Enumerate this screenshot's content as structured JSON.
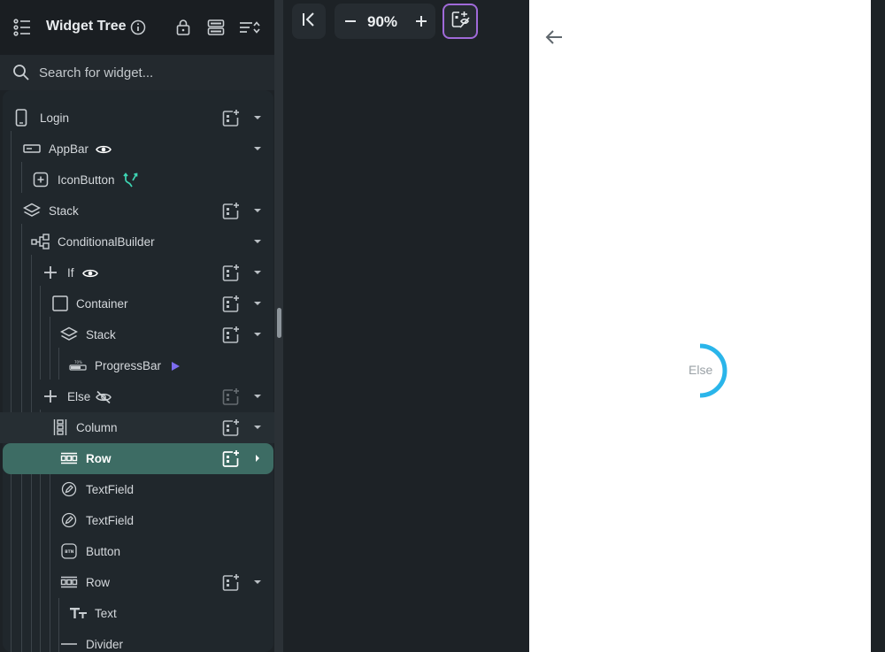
{
  "panel": {
    "title": "Widget Tree",
    "search_placeholder": "Search for widget..."
  },
  "tree": {
    "nodes": [
      {
        "label": "Login",
        "icon": "phone-icon"
      },
      {
        "label": "AppBar",
        "icon": "appbar-icon",
        "badge": "eye-icon"
      },
      {
        "label": "IconButton",
        "icon": "add-box-icon",
        "badge": "branch-icon"
      },
      {
        "label": "Stack",
        "icon": "layers-icon"
      },
      {
        "label": "ConditionalBuilder",
        "icon": "conditional-icon"
      },
      {
        "label": "If",
        "icon": "plus-icon",
        "badge": "eye-icon"
      },
      {
        "label": "Container",
        "icon": "square-icon"
      },
      {
        "label": "Stack",
        "icon": "layers-icon"
      },
      {
        "label": "ProgressBar",
        "icon": "progressbar-icon",
        "badge": "play-icon"
      },
      {
        "label": "Else",
        "icon": "plus-icon",
        "badge": "eye-off-icon"
      },
      {
        "label": "Column",
        "icon": "column-icon"
      },
      {
        "label": "Row",
        "icon": "row-icon"
      },
      {
        "label": "TextField",
        "icon": "edit-icon"
      },
      {
        "label": "TextField",
        "icon": "edit-icon"
      },
      {
        "label": "Button",
        "icon": "button-icon"
      },
      {
        "label": "Row",
        "icon": "row-icon"
      },
      {
        "label": "Text",
        "icon": "text-icon"
      },
      {
        "label": "Divider",
        "icon": "divider-icon"
      }
    ]
  },
  "toolbar": {
    "zoom": "90%"
  },
  "preview": {
    "else_label": "Else"
  },
  "colors": {
    "accent_teal": "#3d6c64",
    "spinner_blue": "#2ab5ea",
    "badge_purple": "#7c6cf0",
    "branch_teal": "#3ed6b4"
  }
}
